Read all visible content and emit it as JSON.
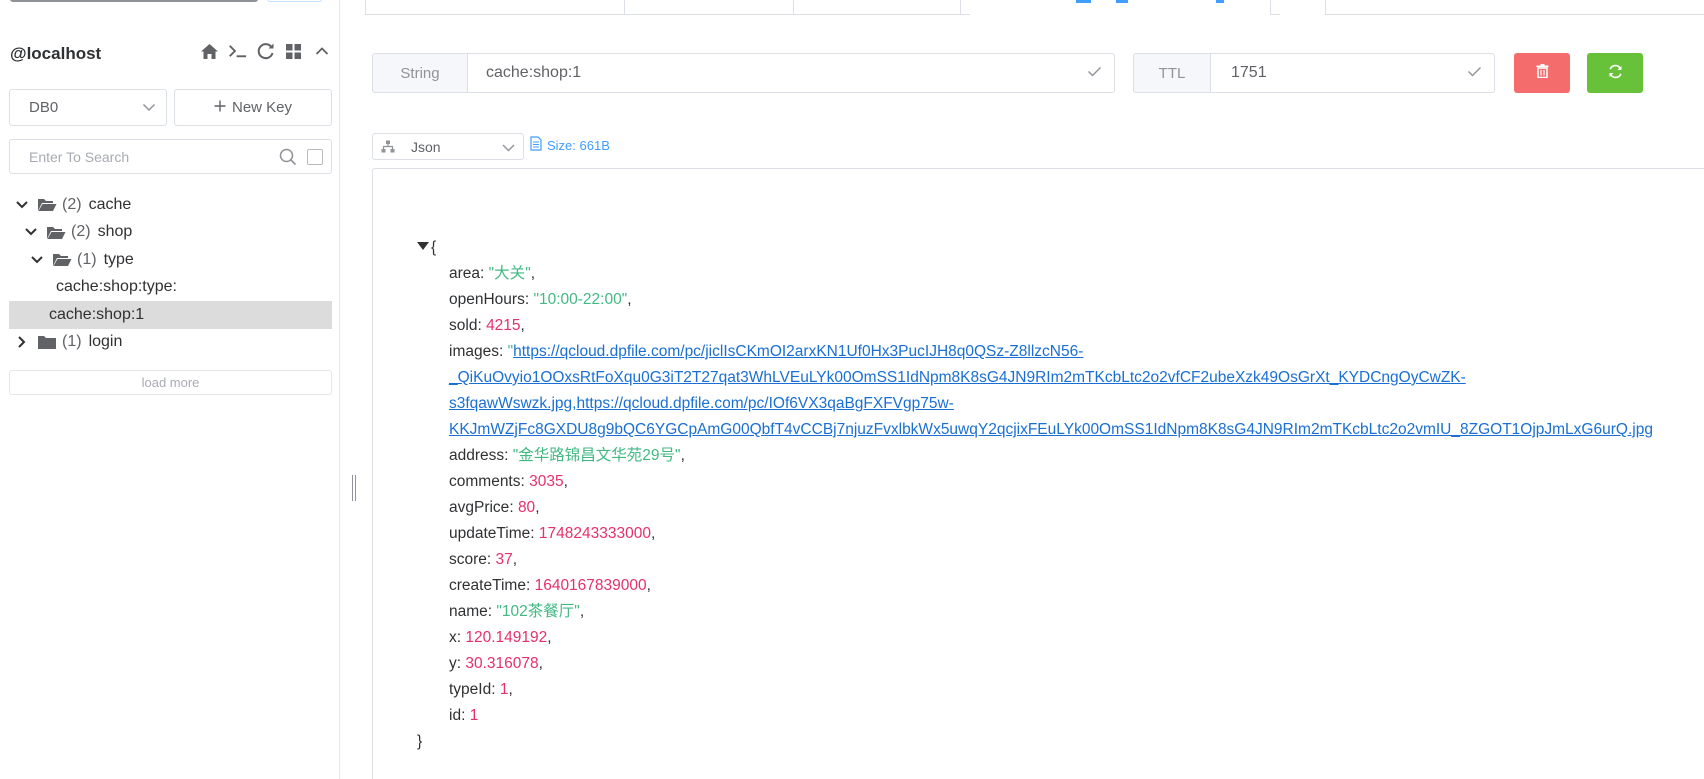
{
  "sidebar": {
    "connection": "@localhost",
    "db_select": "DB0",
    "new_key_label": "New Key",
    "search_placeholder": "Enter To Search",
    "tree": [
      {
        "label": "cache",
        "count": "(2)"
      },
      {
        "label": "shop",
        "count": "(2)"
      },
      {
        "label": "type",
        "count": "(1)"
      },
      {
        "label": "cache:shop:type:"
      },
      {
        "label": "cache:shop:1"
      },
      {
        "label": "login",
        "count": "(1)"
      }
    ],
    "load_more": "load more"
  },
  "toolbar": {
    "type_label": "String",
    "key_value": "cache:shop:1",
    "ttl_label": "TTL",
    "ttl_value": "1751"
  },
  "viewer": {
    "format": "Json",
    "size": "Size: 661B"
  },
  "json": {
    "open": "{",
    "close": "}",
    "fields": [
      {
        "key": "area",
        "value": "大关",
        "type": "string"
      },
      {
        "key": "openHours",
        "value": "10:00-22:00",
        "type": "string"
      },
      {
        "key": "sold",
        "value": "4215",
        "type": "number"
      },
      {
        "key": "images",
        "type": "link",
        "lines": [
          "https://qcloud.dpfile.com/pc/jiclIsCKmOI2arxKN1Uf0Hx3PucIJH8q0QSz-Z8llzcN56-",
          "_QiKuOvyio1OOxsRtFoXqu0G3iT2T27qat3WhLVEuLYk00OmSS1IdNpm8K8sG4JN9RIm2mTKcbLtc2o2vfCF2ubeXzk49OsGrXt_KYDCngOyCwZK-",
          "s3fqawWswzk.jpg,https://qcloud.dpfile.com/pc/IOf6VX3qaBgFXFVgp75w-",
          "KKJmWZjFc8GXDU8g9bQC6YGCpAmG00QbfT4vCCBj7njuzFvxlbkWx5uwqY2qcjixFEuLYk00OmSS1IdNpm8K8sG4JN9RIm2mTKcbLtc2o2vmIU_8ZGOT1OjpJmLxG6urQ.jpg"
        ]
      },
      {
        "key": "address",
        "value": "金华路锦昌文华苑29号",
        "type": "string"
      },
      {
        "key": "comments",
        "value": "3035",
        "type": "number"
      },
      {
        "key": "avgPrice",
        "value": "80",
        "type": "number"
      },
      {
        "key": "updateTime",
        "value": "1748243333000",
        "type": "number"
      },
      {
        "key": "score",
        "value": "37",
        "type": "number"
      },
      {
        "key": "createTime",
        "value": "1640167839000",
        "type": "number"
      },
      {
        "key": "name",
        "value": "102茶餐厅",
        "type": "string"
      },
      {
        "key": "x",
        "value": "120.149192",
        "type": "number"
      },
      {
        "key": "y",
        "value": "30.316078",
        "type": "number"
      },
      {
        "key": "typeId",
        "value": "1",
        "type": "number"
      },
      {
        "key": "id",
        "value": "1",
        "type": "number"
      }
    ]
  },
  "colors": {
    "primary": "#409eff",
    "danger": "#f56c6c",
    "success": "#67c23a",
    "json_string": "#42b983",
    "json_number": "#e5306b",
    "json_link": "#1a6fd4",
    "selected_row": "#dcdcdc"
  },
  "icons": {
    "connection": [
      "home-icon",
      "terminal-icon",
      "refresh-icon",
      "grid-icon",
      "collapse-icon"
    ],
    "delete": "trash-icon",
    "refresh": "refresh-icon",
    "format": "tree-structure-icon",
    "size": "document-icon"
  }
}
